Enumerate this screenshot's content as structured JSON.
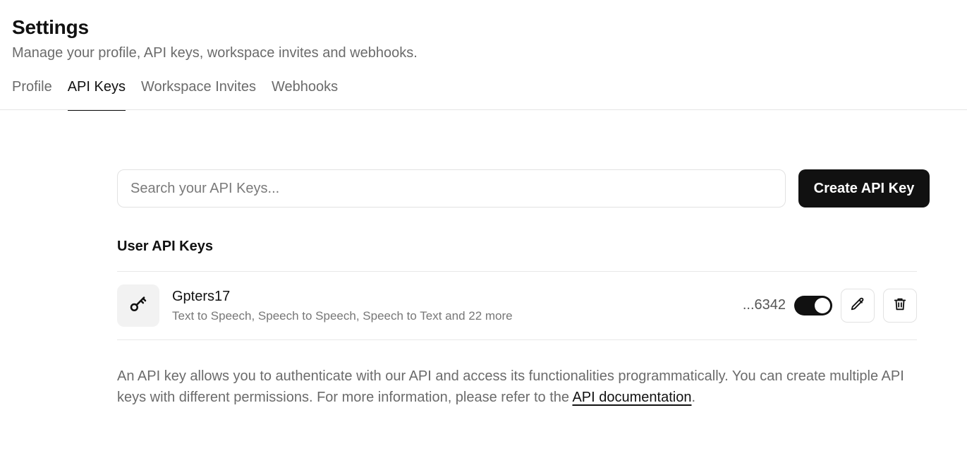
{
  "header": {
    "title": "Settings",
    "subtitle": "Manage your profile, API keys, workspace invites and webhooks."
  },
  "tabs": [
    {
      "label": "Profile",
      "active": false
    },
    {
      "label": "API Keys",
      "active": true
    },
    {
      "label": "Workspace Invites",
      "active": false
    },
    {
      "label": "Webhooks",
      "active": false
    }
  ],
  "search": {
    "placeholder": "Search your API Keys...",
    "value": ""
  },
  "create_button_label": "Create API Key",
  "section_title": "User API Keys",
  "api_keys": [
    {
      "name": "Gpters17",
      "scopes": "Text to Speech, Speech to Speech, Speech to Text and 22 more",
      "suffix": "...6342",
      "enabled": true
    }
  ],
  "info": {
    "text": "An API key allows you to authenticate with our API and access its functionalities programmatically. You can create multiple API keys with different permissions. For more information, please refer to the ",
    "link_label": "API documentation",
    "trailing": "."
  },
  "icons": {
    "key": "key-icon",
    "edit": "pencil-icon",
    "delete": "trash-icon"
  },
  "colors": {
    "primary": "#111111",
    "muted_text": "#6b6b6b",
    "border": "#e2e2e2"
  }
}
